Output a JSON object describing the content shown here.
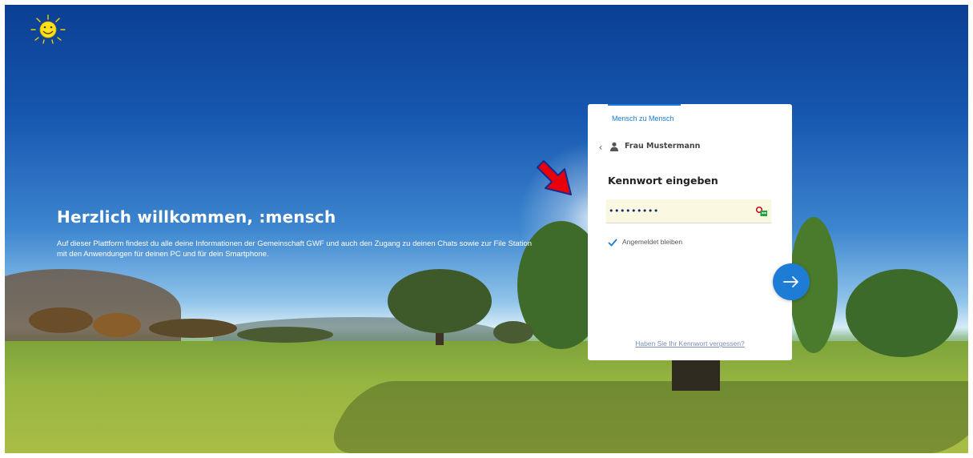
{
  "welcome": {
    "title": "Herzlich willkommen, :mensch",
    "text": "Auf dieser Plattform findest du alle deine Informationen der Gemeinschaft GWF und auch den Zugang zu deinen Chats sowie zur File Station mit den Anwendungen für deinen PC und für dein Smartphone."
  },
  "login": {
    "brand": "Mensch zu Mensch",
    "user_name": "Frau Mustermann",
    "heading": "Kennwort eingeben",
    "password_masked": "•••••••••",
    "remember_label": "Angemeldet bleiben",
    "remember_checked": true,
    "forgot_link": "Haben Sie Ihr Kennwort vergessen?"
  },
  "icons": {
    "logo": "sun-logo-icon",
    "back": "chevron-left-icon",
    "user": "user-icon",
    "key": "key-icon",
    "next": "arrow-right-icon",
    "annotation": "red-arrow-icon"
  },
  "colors": {
    "accent": "#1e7bd6",
    "card_bg": "#ffffff",
    "field_bg": "#fbf8e2",
    "annotation_red": "#e8000b"
  }
}
